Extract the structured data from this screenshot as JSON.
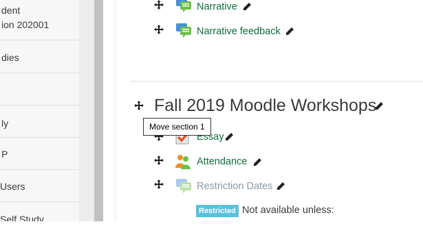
{
  "sidebar": {
    "items": [
      {
        "line1": "dent",
        "line2": "ion 202001"
      },
      {
        "line1": "dies"
      },
      {
        "line1": ""
      },
      {
        "line1": "ly"
      },
      {
        "line1": "P"
      },
      {
        "line1": " Users"
      },
      {
        "line1": "Self Study"
      }
    ]
  },
  "section0": {
    "activities": [
      {
        "name": "Narrative",
        "icon": "feedback-icon"
      },
      {
        "name": "Narrative feedback",
        "icon": "feedback-icon"
      }
    ]
  },
  "section1": {
    "title": "Fall 2019 Moodle Workshops",
    "tooltip": "Move section 1",
    "activities": [
      {
        "name": "Essay",
        "icon": "assignment-icon"
      },
      {
        "name": "Attendance",
        "icon": "attendance-icon"
      },
      {
        "name": "Restriction Dates",
        "icon": "feedback-icon-dimmed"
      }
    ],
    "restriction": {
      "badge": "Restricted",
      "text": "Not available unless:"
    }
  },
  "colors": {
    "link": "#0f6b3e",
    "dimmed_link": "#8a9aa6",
    "badge": "#5bc0de"
  }
}
